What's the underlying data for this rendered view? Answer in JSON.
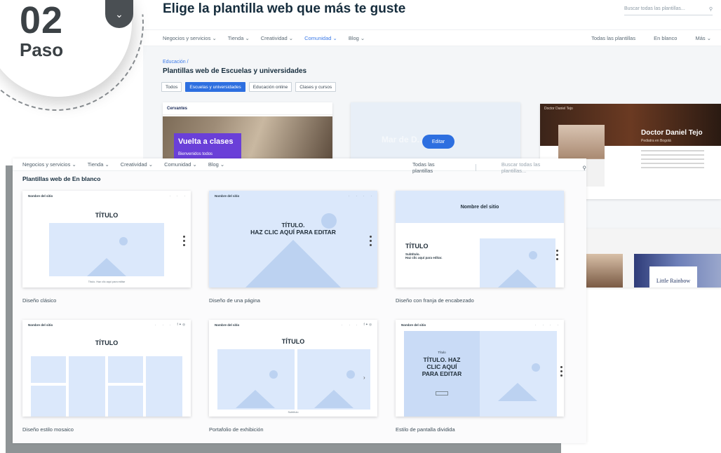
{
  "badge": {
    "number": "02",
    "word": "Paso",
    "arrow_icon": "chevron-down-icon"
  },
  "top": {
    "heading": "Elige la plantilla web que más te guste",
    "search_placeholder": "Buscar todas las plantillas...",
    "nav_left": [
      "Negocios y servicios ⌄",
      "Tienda ⌄",
      "Creatividad ⌄",
      "Comunidad ⌄",
      "Blog ⌄"
    ],
    "nav_active_index": 3,
    "nav_right": [
      "Todas las plantillas",
      "En blanco",
      "Más ⌄"
    ],
    "breadcrumb": "Educación /",
    "subheading": "Plantillas web de Escuelas y universidades",
    "filters": [
      "Todos",
      "Escuelas y universidades",
      "Educación online",
      "Clases y cursos"
    ],
    "filter_active_index": 1,
    "tpl_school": {
      "logo": "Cervantes",
      "banner_title": "Vuelta a clases",
      "banner_sub": "Bienvenidos todos"
    },
    "tpl_blank": {
      "ghost": "Mar de D...",
      "edit_label": "Editar"
    },
    "tpl_doctor": {
      "nav_name": "Doctor Daniel Tejo",
      "name": "Doctor Daniel Tejo",
      "role": "Pediatra en Bogotá"
    },
    "tpl_preschool": {
      "card_title": "Little Rainbow"
    }
  },
  "panel": {
    "nav_left": [
      "Negocios y servicios ⌄",
      "Tienda ⌄",
      "Creatividad ⌄",
      "Comunidad ⌄",
      "Blog ⌄"
    ],
    "nav_right_all": "Todas las plantillas",
    "search_placeholder": "Buscar todas las plantillas...",
    "title": "Plantillas web de En blanco",
    "cards": [
      {
        "label": "Diseño clásico",
        "heading": "TÍTULO",
        "caption": "Título. Haz clic aquí para editar",
        "site": "Nombre del sitio"
      },
      {
        "label": "Diseño de una página",
        "heading": "TÍTULO.\nHAZ CLIC AQUÍ PARA EDITAR",
        "site": "Nombre del sitio"
      },
      {
        "label": "Diseño con franja de encabezado",
        "heading": "TÍTULO",
        "site_banner": "Nombre del sitio",
        "subtitle": "Subtítulo.\nHaz clic aquí para editar."
      },
      {
        "label": "Diseño estilo mosaico",
        "heading": "TÍTULO",
        "site": "Nombre del sitio"
      },
      {
        "label": "Portafolio de exhibición",
        "heading": "TÍTULO",
        "caption": "Subtítulo",
        "site": "Nombre del sitio"
      },
      {
        "label": "Estilo de pantalla dividida",
        "heading": "TÍTULO. HAZ\nCLIC AQUÍ\nPARA EDITAR",
        "kicker": "Título",
        "site": "Nombre del sitio"
      }
    ]
  },
  "colors": {
    "accent": "#2d6fe0",
    "placeholder_blue": "#dbe8fb",
    "shadow_gray": "#8f9496"
  }
}
